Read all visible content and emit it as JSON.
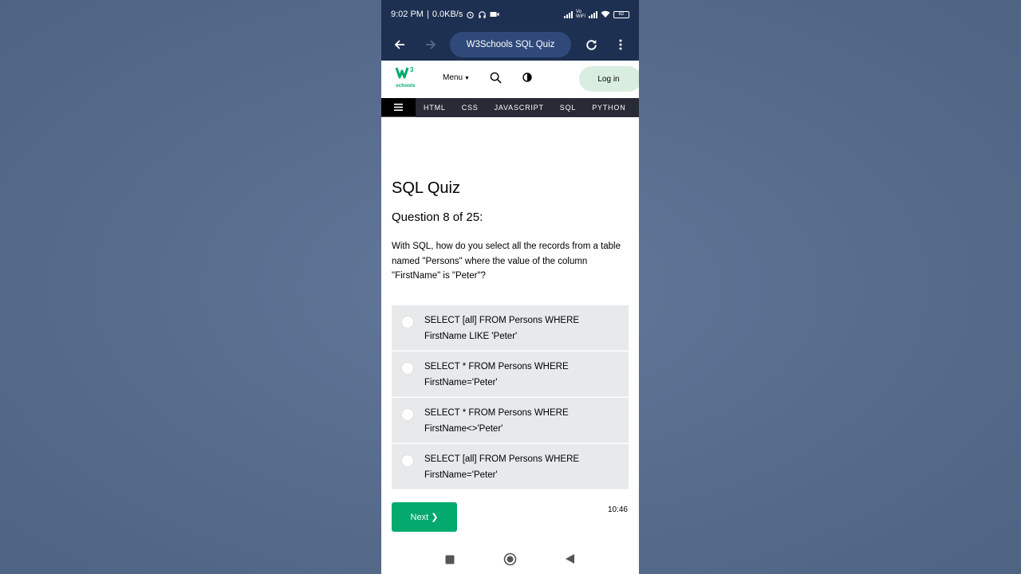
{
  "statusbar": {
    "time": "9:02 PM",
    "speed": "0.0KB/s",
    "vowifi": "Vo WiFi",
    "battery": "82"
  },
  "browser": {
    "url_title": "W3Schools SQL Quiz"
  },
  "site_header": {
    "logo_text": "schools",
    "menu_label": "Menu",
    "login_label": "Log in"
  },
  "topnav": {
    "items": [
      "HTML",
      "CSS",
      "JAVASCRIPT",
      "SQL",
      "PYTHON"
    ]
  },
  "quiz": {
    "title": "SQL Quiz",
    "question_number": "Question 8 of 25:",
    "question_text": "With SQL, how do you select all the records from a table named \"Persons\" where the value of the column \"FirstName\" is \"Peter\"?",
    "options": [
      "SELECT [all] FROM Persons WHERE FirstName LIKE 'Peter'",
      "SELECT * FROM Persons WHERE FirstName='Peter'",
      "SELECT * FROM Persons WHERE FirstName<>'Peter'",
      "SELECT [all] FROM Persons WHERE FirstName='Peter'"
    ],
    "next_label": "Next ❯",
    "timer": "10:46"
  },
  "colors": {
    "brand_green": "#04aa6d",
    "browser_bar": "#1e3052",
    "topnav_bg": "#282a35"
  }
}
